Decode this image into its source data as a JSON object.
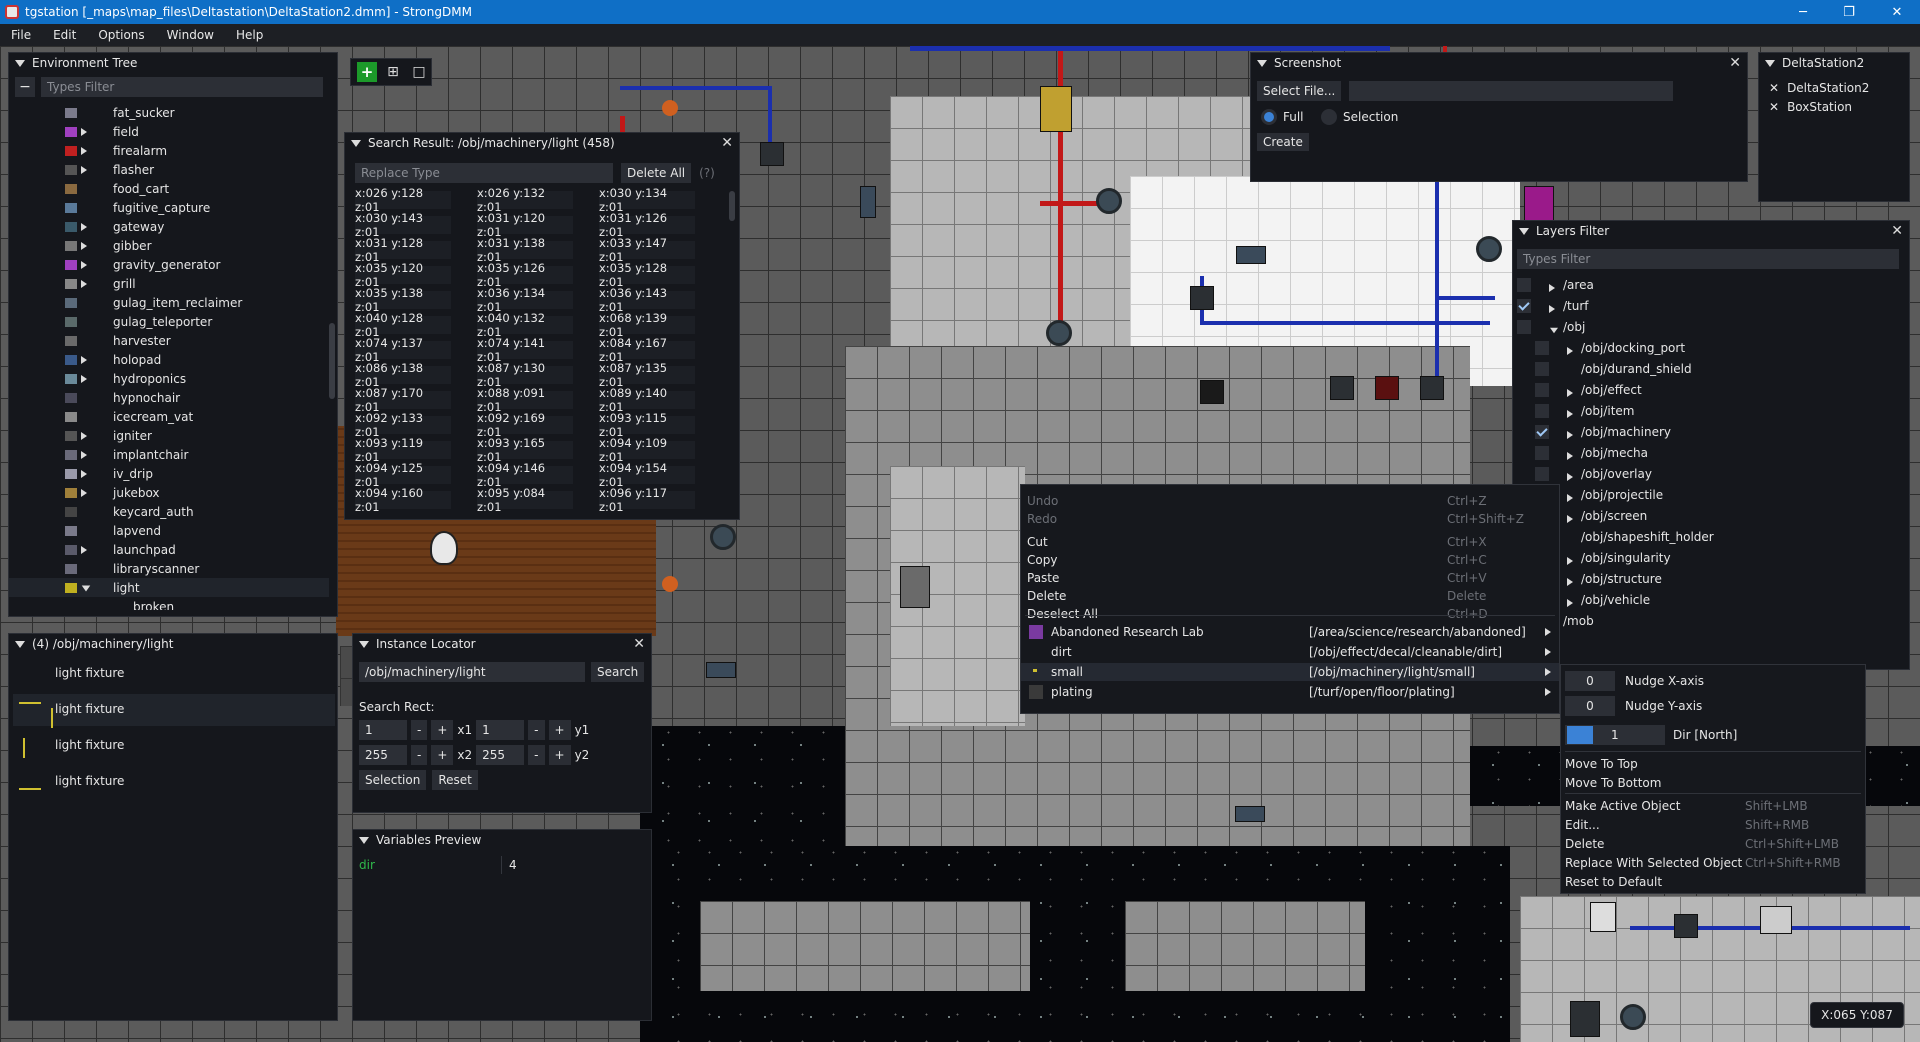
{
  "window": {
    "title": "tgstation [_maps\\map_files\\Deltastation\\DeltaStation2.dmm] - StrongDMM",
    "minimize": "─",
    "maximize": "❐",
    "close": "✕"
  },
  "menubar": [
    "File",
    "Edit",
    "Options",
    "Window",
    "Help"
  ],
  "toolbar": {
    "add": "+",
    "grid": "⊞",
    "select": "□"
  },
  "env_tree": {
    "title": "Environment Tree",
    "filter_placeholder": "Types Filter",
    "collapse": "−",
    "items": [
      {
        "label": "fat_sucker",
        "arrow": false,
        "icon": "#7b7b8c"
      },
      {
        "label": "field",
        "arrow": true,
        "icon": "#a040c0"
      },
      {
        "label": "firealarm",
        "arrow": true,
        "icon": "#c02020"
      },
      {
        "label": "flasher",
        "arrow": true,
        "icon": "#555"
      },
      {
        "label": "food_cart",
        "arrow": false,
        "icon": "#8a6a40"
      },
      {
        "label": "fugitive_capture",
        "arrow": false,
        "icon": "#5a7a9a"
      },
      {
        "label": "gateway",
        "arrow": true,
        "icon": "#3a5a6a"
      },
      {
        "label": "gibber",
        "arrow": true,
        "icon": "#777"
      },
      {
        "label": "gravity_generator",
        "arrow": true,
        "icon": "#a040c0"
      },
      {
        "label": "grill",
        "arrow": true,
        "icon": "#888"
      },
      {
        "label": "gulag_item_reclaimer",
        "arrow": false,
        "icon": "#5a6a7a"
      },
      {
        "label": "gulag_teleporter",
        "arrow": false,
        "icon": "#5a6a6a"
      },
      {
        "label": "harvester",
        "arrow": false,
        "icon": "#6a6a6a"
      },
      {
        "label": "holopad",
        "arrow": true,
        "icon": "#3a5a8a"
      },
      {
        "label": "hydroponics",
        "arrow": true,
        "icon": "#6a8a9a"
      },
      {
        "label": "hypnochair",
        "arrow": false,
        "icon": "#4a4a5a"
      },
      {
        "label": "icecream_vat",
        "arrow": false,
        "icon": "#8a8a8a"
      },
      {
        "label": "igniter",
        "arrow": true,
        "icon": "#555"
      },
      {
        "label": "implantchair",
        "arrow": true,
        "icon": "#6a6a7a"
      },
      {
        "label": "iv_drip",
        "arrow": true,
        "icon": "#9a9aaa"
      },
      {
        "label": "jukebox",
        "arrow": true,
        "icon": "#a0803a"
      },
      {
        "label": "keycard_auth",
        "arrow": false,
        "icon": "#444"
      },
      {
        "label": "lapvend",
        "arrow": false,
        "icon": "#7a7a8a"
      },
      {
        "label": "launchpad",
        "arrow": true,
        "icon": "#5a5a6a"
      },
      {
        "label": "libraryscanner",
        "arrow": false,
        "icon": "#6a6a7a"
      },
      {
        "label": "light",
        "arrow": true,
        "expanded": true,
        "icon": "#c0b020"
      },
      {
        "label": "broken",
        "arrow": false,
        "child": true,
        "icon": ""
      }
    ]
  },
  "instances": {
    "title": "(4) /obj/machinery/light",
    "items": [
      "light fixture",
      "light fixture",
      "light fixture",
      "light fixture"
    ]
  },
  "search_result": {
    "title": "Search Result: /obj/machinery/light (458)",
    "replace_placeholder": "Replace Type",
    "delete_all": "Delete All",
    "help": "(?)",
    "coords": [
      "x:026 y:128 z:01",
      "x:026 y:132 z:01",
      "x:030 y:134 z:01",
      "x:030 y:143 z:01",
      "x:031 y:120 z:01",
      "x:031 y:126 z:01",
      "x:031 y:128 z:01",
      "x:031 y:138 z:01",
      "x:033 y:147 z:01",
      "x:035 y:120 z:01",
      "x:035 y:126 z:01",
      "x:035 y:128 z:01",
      "x:035 y:138 z:01",
      "x:036 y:134 z:01",
      "x:036 y:143 z:01",
      "x:040 y:128 z:01",
      "x:040 y:132 z:01",
      "x:068 y:139 z:01",
      "x:074 y:137 z:01",
      "x:074 y:141 z:01",
      "x:084 y:167 z:01",
      "x:086 y:138 z:01",
      "x:087 y:130 z:01",
      "x:087 y:135 z:01",
      "x:087 y:170 z:01",
      "x:088 y:091 z:01",
      "x:089 y:140 z:01",
      "x:092 y:133 z:01",
      "x:092 y:169 z:01",
      "x:093 y:115 z:01",
      "x:093 y:119 z:01",
      "x:093 y:165 z:01",
      "x:094 y:109 z:01",
      "x:094 y:125 z:01",
      "x:094 y:146 z:01",
      "x:094 y:154 z:01",
      "x:094 y:160 z:01",
      "x:095 y:084 z:01",
      "x:096 y:117 z:01"
    ]
  },
  "instance_locator": {
    "title": "Instance Locator",
    "path": "/obj/machinery/light",
    "search": "Search",
    "rect_label": "Search Rect:",
    "x1": "1",
    "y1": "1",
    "x2": "255",
    "y2": "255",
    "x1_label": "x1",
    "y1_label": "y1",
    "x2_label": "x2",
    "y2_label": "y2",
    "minus": "-",
    "plus": "+",
    "selection": "Selection",
    "reset": "Reset"
  },
  "variables": {
    "title": "Variables Preview",
    "name": "dir",
    "value": "4"
  },
  "screenshot": {
    "title": "Screenshot",
    "select_file": "Select File...",
    "path": "",
    "full": "Full",
    "selection": "Selection",
    "create": "Create",
    "mode": "Full"
  },
  "maps": {
    "title": "DeltaStation2",
    "items": [
      "DeltaStation2",
      "BoxStation"
    ]
  },
  "layers": {
    "title": "Layers Filter",
    "filter_placeholder": "Types Filter",
    "items": [
      {
        "label": "/area",
        "indent": 0,
        "arrow": true,
        "checked": false
      },
      {
        "label": "/turf",
        "indent": 0,
        "arrow": true,
        "checked": true
      },
      {
        "label": "/obj",
        "indent": 0,
        "arrow": true,
        "expanded": true,
        "checked": false
      },
      {
        "label": "/obj/docking_port",
        "indent": 1,
        "arrow": true,
        "checked": false
      },
      {
        "label": "/obj/durand_shield",
        "indent": 1,
        "arrow": false,
        "checked": false
      },
      {
        "label": "/obj/effect",
        "indent": 1,
        "arrow": true,
        "checked": false
      },
      {
        "label": "/obj/item",
        "indent": 1,
        "arrow": true,
        "checked": false
      },
      {
        "label": "/obj/machinery",
        "indent": 1,
        "arrow": true,
        "checked": true
      },
      {
        "label": "/obj/mecha",
        "indent": 1,
        "arrow": true,
        "checked": false
      },
      {
        "label": "/obj/overlay",
        "indent": 1,
        "arrow": true,
        "checked": false
      },
      {
        "label": "/obj/projectile",
        "indent": 1,
        "arrow": true,
        "checked": false
      },
      {
        "label": "/obj/screen",
        "indent": 1,
        "arrow": true,
        "checked": false
      },
      {
        "label": "/obj/shapeshift_holder",
        "indent": 1,
        "arrow": false,
        "checked": false
      },
      {
        "label": "/obj/singularity",
        "indent": 1,
        "arrow": true,
        "checked": false
      },
      {
        "label": "/obj/structure",
        "indent": 1,
        "arrow": true,
        "checked": false
      },
      {
        "label": "/obj/vehicle",
        "indent": 1,
        "arrow": true,
        "checked": false
      },
      {
        "label": "/mob",
        "indent": 0,
        "arrow": false,
        "checked": false
      }
    ]
  },
  "context_menu": {
    "edit": [
      {
        "label": "Undo",
        "shortcut": "Ctrl+Z",
        "disabled": true
      },
      {
        "label": "Redo",
        "shortcut": "Ctrl+Shift+Z",
        "disabled": true
      },
      {
        "label": "Cut",
        "shortcut": "Ctrl+X"
      },
      {
        "label": "Copy",
        "shortcut": "Ctrl+C"
      },
      {
        "label": "Paste",
        "shortcut": "Ctrl+V"
      },
      {
        "label": "Delete",
        "shortcut": "Delete"
      },
      {
        "label": "Deselect All",
        "shortcut": "Ctrl+D"
      }
    ],
    "objects": [
      {
        "label": "Abandoned Research Lab",
        "path": "[/area/science/research/abandoned]",
        "icon": "#7a3aa0"
      },
      {
        "label": "dirt",
        "path": "[/obj/effect/decal/cleanable/dirt]",
        "icon": ""
      },
      {
        "label": "small",
        "path": "[/obj/machinery/light/small]",
        "icon": "#c0b020",
        "highlight": true
      },
      {
        "label": "plating",
        "path": "[/turf/open/floor/plating]",
        "icon": "#3a3a3a"
      }
    ]
  },
  "submenu": {
    "nudge_x": "0",
    "nudge_x_label": "Nudge X-axis",
    "nudge_y": "0",
    "nudge_y_label": "Nudge Y-axis",
    "dir": "1",
    "dir_label": "Dir [North]",
    "items": [
      {
        "label": "Move To Top",
        "shortcut": ""
      },
      {
        "label": "Move To Bottom",
        "shortcut": ""
      },
      {
        "label": "Make Active Object",
        "shortcut": "Shift+LMB"
      },
      {
        "label": "Edit...",
        "shortcut": "Shift+RMB"
      },
      {
        "label": "Delete",
        "shortcut": "Ctrl+Shift+LMB"
      },
      {
        "label": "Replace With Selected Object",
        "shortcut": "Ctrl+Shift+RMB"
      },
      {
        "label": "Reset to Default",
        "shortcut": ""
      }
    ]
  },
  "coords_readout": "X:065 Y:087"
}
